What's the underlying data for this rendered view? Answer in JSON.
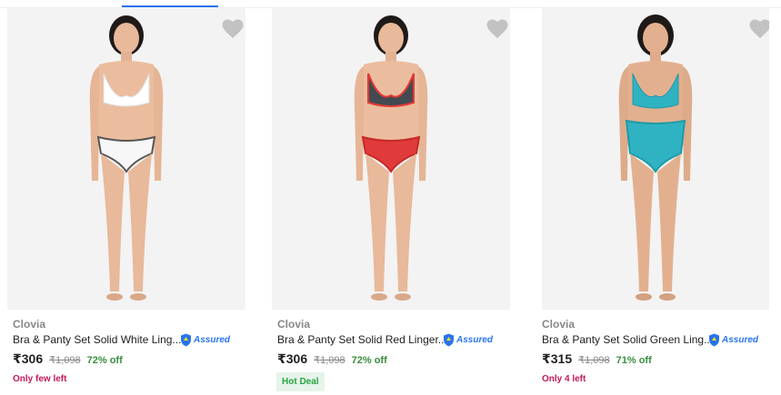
{
  "products": [
    {
      "brand": "Clovia",
      "title": "Bra & Panty Set Solid White Ling...",
      "assured": "Assured",
      "price": "₹306",
      "mrp": "₹1,098",
      "discount": "72% off",
      "tag": "Only few left",
      "tag_type": "stock",
      "bra_color": "#ffffff",
      "panty_color": "#f7f7f7",
      "panty_trim": "#555555"
    },
    {
      "brand": "Clovia",
      "title": "Bra & Panty Set Solid Red Linger...",
      "assured": "Assured",
      "price": "₹306",
      "mrp": "₹1,098",
      "discount": "72% off",
      "tag": "Hot Deal",
      "tag_type": "deal",
      "bra_color": "#444a52",
      "panty_color": "#e03a3a",
      "panty_trim": "#c62828"
    },
    {
      "brand": "Clovia",
      "title": "Bra & Panty Set Solid Green Ling...",
      "assured": "Assured",
      "price": "₹315",
      "mrp": "₹1,098",
      "discount": "71% off",
      "tag": "Only 4 left",
      "tag_type": "stock",
      "bra_color": "#2fb3c2",
      "panty_color": "#2fb3c2",
      "panty_trim": "#1e9aa8"
    }
  ],
  "icons": {
    "wishlist": "heart-icon",
    "assured": "shield-icon"
  }
}
